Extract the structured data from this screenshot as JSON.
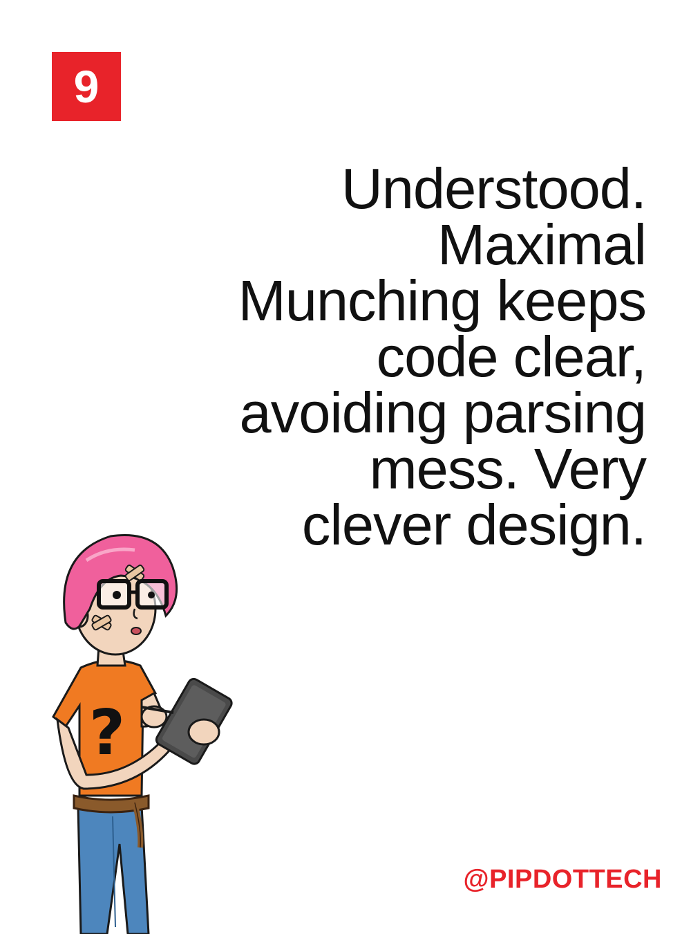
{
  "page": {
    "number": "9"
  },
  "quote": {
    "lines": [
      "Understood.",
      "Maximal",
      "Munching keeps",
      "code clear,",
      "avoiding parsing",
      "mess. Very",
      "clever design."
    ]
  },
  "footer": {
    "handle": "@PIPDOTTECH"
  },
  "colors": {
    "accent": "#e8232a",
    "text": "#111111",
    "background": "#ffffff"
  },
  "illustration": {
    "icon": "character-with-tablet-illustration"
  }
}
